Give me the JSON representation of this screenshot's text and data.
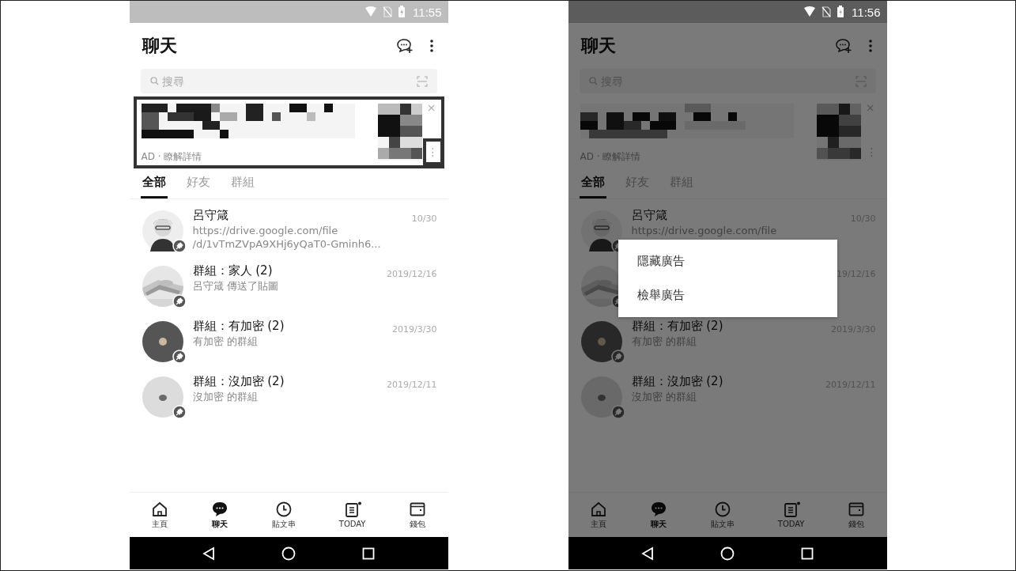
{
  "screens": [
    {
      "status_time": "11:55",
      "title": "聊天",
      "search": {
        "placeholder": "搜尋"
      },
      "ad": {
        "label": "AD · 瞭解詳情",
        "close": "×",
        "more": "⋮",
        "highlighted": true
      },
      "tabs": [
        {
          "label": "全部",
          "selected": true
        },
        {
          "label": "好友",
          "selected": false
        },
        {
          "label": "群組",
          "selected": false
        }
      ],
      "chats": [
        {
          "kind": "person",
          "name": "呂守箴",
          "preview": [
            "https://drive.google.com/file",
            "/d/1vTmZVpA9XHj6yQaT0-Gminh6..."
          ],
          "date": "10/30"
        },
        {
          "name": "群組：家人 (2)",
          "preview": [
            "呂守箴 傳送了貼圖"
          ],
          "date": "2019/12/16"
        },
        {
          "kind": "dark",
          "name": "群組：有加密 (2)",
          "preview": [
            "有加密  的群組"
          ],
          "date": "2019/3/30"
        },
        {
          "kind": "light",
          "name": "群組：沒加密 (2)",
          "preview": [
            "沒加密  的群組"
          ],
          "date": "2019/12/11"
        }
      ],
      "nav": [
        {
          "kind": "home",
          "label": "主頁",
          "selected": false
        },
        {
          "kind": "chat",
          "label": "聊天",
          "selected": true
        },
        {
          "kind": "clock",
          "label": "貼文串",
          "selected": false
        },
        {
          "kind": "news",
          "label": "TODAY",
          "selected": false
        },
        {
          "kind": "wallet",
          "label": "錢包",
          "selected": false
        }
      ],
      "dimmed": false
    },
    {
      "status_time": "11:56",
      "title": "聊天",
      "search": {
        "placeholder": "搜尋"
      },
      "ad": {
        "label": "AD · 瞭解詳情",
        "close": "×",
        "more": "⋮",
        "highlighted": false
      },
      "tabs": [
        {
          "label": "全部",
          "selected": true
        },
        {
          "label": "好友",
          "selected": false
        },
        {
          "label": "群組",
          "selected": false
        }
      ],
      "chats": [
        {
          "kind": "person",
          "name": "呂守箴",
          "preview": [
            "https://drive.google.com/file"
          ],
          "date": "10/30"
        },
        {
          "date": "19/12/16"
        },
        {
          "kind": "dark",
          "name": "群組：有加密 (2)",
          "preview": [
            "有加密  的群組"
          ],
          "date": "2019/3/30"
        },
        {
          "kind": "light",
          "name": "群組：沒加密 (2)",
          "preview": [
            "沒加密  的群組"
          ],
          "date": "2019/12/11"
        }
      ],
      "nav": [
        {
          "kind": "home",
          "label": "主頁",
          "selected": false
        },
        {
          "kind": "chat",
          "label": "聊天",
          "selected": true
        },
        {
          "kind": "clock",
          "label": "貼文串",
          "selected": false
        },
        {
          "kind": "news",
          "label": "TODAY",
          "selected": false
        },
        {
          "kind": "wallet",
          "label": "錢包",
          "selected": false
        }
      ],
      "dimmed": true,
      "menu": [
        "隱藏廣告",
        "檢舉廣告"
      ]
    }
  ]
}
